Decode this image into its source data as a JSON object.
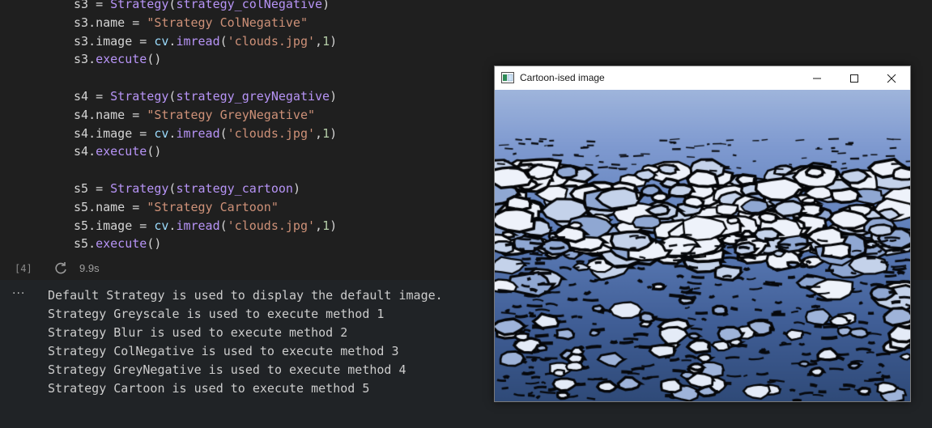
{
  "code": {
    "lines": [
      [
        "s3",
        " = ",
        "Strategy",
        "(",
        "strategy_colNegative",
        ")"
      ],
      [
        "s3",
        ".name = ",
        "\"Strategy ColNegative\""
      ],
      [
        "s3",
        ".image = ",
        "cv",
        ".",
        "imread",
        "(",
        "'clouds.jpg'",
        ",",
        "1",
        ")"
      ],
      [
        "s3",
        ".",
        "execute",
        "()"
      ],
      [],
      [
        "s4",
        " = ",
        "Strategy",
        "(",
        "strategy_greyNegative",
        ")"
      ],
      [
        "s4",
        ".name = ",
        "\"Strategy GreyNegative\""
      ],
      [
        "s4",
        ".image = ",
        "cv",
        ".",
        "imread",
        "(",
        "'clouds.jpg'",
        ",",
        "1",
        ")"
      ],
      [
        "s4",
        ".",
        "execute",
        "()"
      ],
      [],
      [
        "s5",
        " = ",
        "Strategy",
        "(",
        "strategy_cartoon",
        ")"
      ],
      [
        "s5",
        ".name = ",
        "\"Strategy Cartoon\""
      ],
      [
        "s5",
        ".image = ",
        "cv",
        ".",
        "imread",
        "(",
        "'clouds.jpg'",
        ",",
        "1",
        ")"
      ],
      [
        "s5",
        ".",
        "execute",
        "()"
      ]
    ]
  },
  "cell": {
    "execution_count": "[4]",
    "status_icon": "refresh-icon",
    "exec_time": "9.9s"
  },
  "output": {
    "menu_label": "···",
    "lines": [
      "Default Strategy is used to display the default image.",
      "Strategy Greyscale is used to execute method 1",
      "Strategy Blur is used to execute method 2",
      "Strategy ColNegative is used to execute method 3",
      "Strategy GreyNegative is used to execute method 4",
      "Strategy Cartoon is used to execute method 5"
    ]
  },
  "window": {
    "title": "Cartoon-ised image",
    "icon": "app-window-icon",
    "controls": [
      "minimize-icon",
      "maximize-icon",
      "close-icon"
    ]
  },
  "colors": {
    "editor_bg": "#1f1f1f",
    "output_bg": "#202326",
    "window_titlebar": "#ffffff"
  }
}
